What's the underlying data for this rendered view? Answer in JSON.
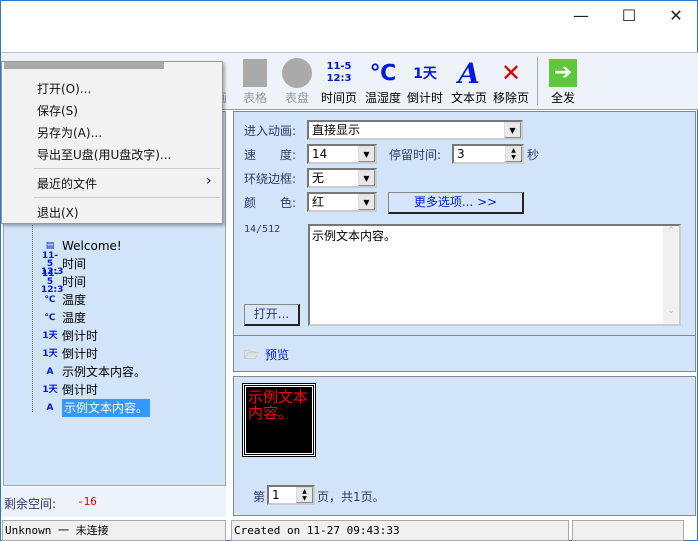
{
  "window": {
    "min": "—",
    "max": "☐",
    "close": "✕"
  },
  "toolbar": {
    "items": [
      {
        "label": "表格",
        "icon": "table-icon",
        "disabled": true
      },
      {
        "label": "表盘",
        "icon": "dial-icon",
        "disabled": true
      },
      {
        "label": "时间页",
        "icon": "time-icon",
        "glyph": "11-5\n12:3"
      },
      {
        "label": "温湿度",
        "icon": "temperature-icon",
        "glyph": "℃"
      },
      {
        "label": "倒计时",
        "icon": "countdown-icon",
        "glyph": "1天"
      },
      {
        "label": "文本页",
        "icon": "text-icon",
        "glyph": "A"
      },
      {
        "label": "移除页",
        "icon": "remove-icon",
        "glyph": "✕"
      },
      {
        "label": "全发",
        "icon": "send-all-icon",
        "glyph": "➔"
      }
    ],
    "partial_label": "画"
  },
  "menu": {
    "items": [
      "打开(O)...",
      "保存(S)",
      "另存为(A)...",
      "导出至U盘(用U盘改字)...",
      "最近的文件",
      "退出(X)"
    ],
    "submenu_arrow": "›"
  },
  "tree": {
    "items": [
      {
        "label": "Welcome!",
        "glyph": "▤"
      },
      {
        "label": "时间",
        "glyph": "11-5 12:3"
      },
      {
        "label": "时间",
        "glyph": "11-5 12:3"
      },
      {
        "label": "温度",
        "glyph": "℃"
      },
      {
        "label": "温度",
        "glyph": "℃"
      },
      {
        "label": "倒计时",
        "glyph": "1天"
      },
      {
        "label": "倒计时",
        "glyph": "1天"
      },
      {
        "label": "示例文本内容。",
        "glyph": "A"
      },
      {
        "label": "倒计时",
        "glyph": "1天"
      },
      {
        "label": "示例文本内容。",
        "glyph": "A",
        "selected": true
      }
    ]
  },
  "space": {
    "label": "剩余空间:",
    "value": "-16"
  },
  "form": {
    "animation_label": "进入动画:",
    "animation_value": "直接显示",
    "speed_label": "速　　度:",
    "speed_value": "14",
    "stay_label": "停留时间:",
    "stay_value": "3",
    "stay_unit": "秒",
    "border_label": "环绕边框:",
    "border_value": "无",
    "color_label": "颜　　色:",
    "color_value": "红",
    "more_button": "更多选项... >>",
    "char_count": "14/512",
    "text": "示例文本内容。",
    "open_button": "打开..."
  },
  "preview": {
    "link": "预览",
    "led_text": "示例文本内容。",
    "page_prefix": "第",
    "page_value": "1",
    "page_suffix": "页，共1页。",
    "led_color": "#ff0000"
  },
  "status": {
    "connection": "Unknown 一 未连接",
    "created": "Created on 11-27 09:43:33"
  }
}
